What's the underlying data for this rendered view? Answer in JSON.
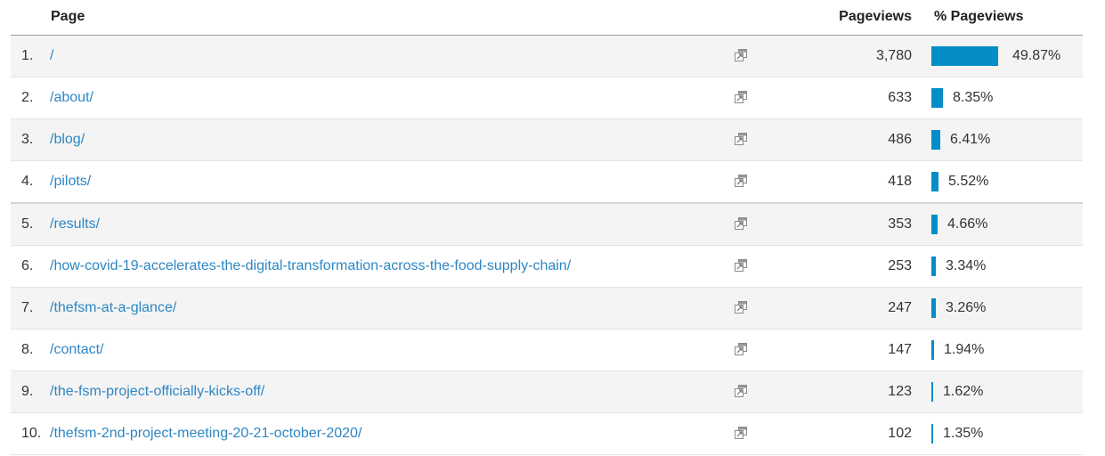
{
  "header": {
    "page": "Page",
    "pageviews": "Pageviews",
    "pct_pageviews": "% Pageviews"
  },
  "colors": {
    "bar": "#058dc7",
    "link": "#2d86c4"
  },
  "icons": {
    "row_action": "open-in-new-window-icon"
  },
  "rows": [
    {
      "rank": "1.",
      "page": "/",
      "pageviews": "3,780",
      "pct": "49.87%",
      "pct_value": 49.87
    },
    {
      "rank": "2.",
      "page": "/about/",
      "pageviews": "633",
      "pct": "8.35%",
      "pct_value": 8.35
    },
    {
      "rank": "3.",
      "page": "/blog/",
      "pageviews": "486",
      "pct": "6.41%",
      "pct_value": 6.41
    },
    {
      "rank": "4.",
      "page": "/pilots/",
      "pageviews": "418",
      "pct": "5.52%",
      "pct_value": 5.52
    },
    {
      "rank": "5.",
      "page": "/results/",
      "pageviews": "353",
      "pct": "4.66%",
      "pct_value": 4.66
    },
    {
      "rank": "6.",
      "page": "/how-covid-19-accelerates-the-digital-transformation-across-the-food-supply-chain/",
      "pageviews": "253",
      "pct": "3.34%",
      "pct_value": 3.34
    },
    {
      "rank": "7.",
      "page": "/thefsm-at-a-glance/",
      "pageviews": "247",
      "pct": "3.26%",
      "pct_value": 3.26
    },
    {
      "rank": "8.",
      "page": "/contact/",
      "pageviews": "147",
      "pct": "1.94%",
      "pct_value": 1.94
    },
    {
      "rank": "9.",
      "page": "/the-fsm-project-officially-kicks-off/",
      "pageviews": "123",
      "pct": "1.62%",
      "pct_value": 1.62
    },
    {
      "rank": "10.",
      "page": "/thefsm-2nd-project-meeting-20-21-october-2020/",
      "pageviews": "102",
      "pct": "1.35%",
      "pct_value": 1.35
    }
  ]
}
